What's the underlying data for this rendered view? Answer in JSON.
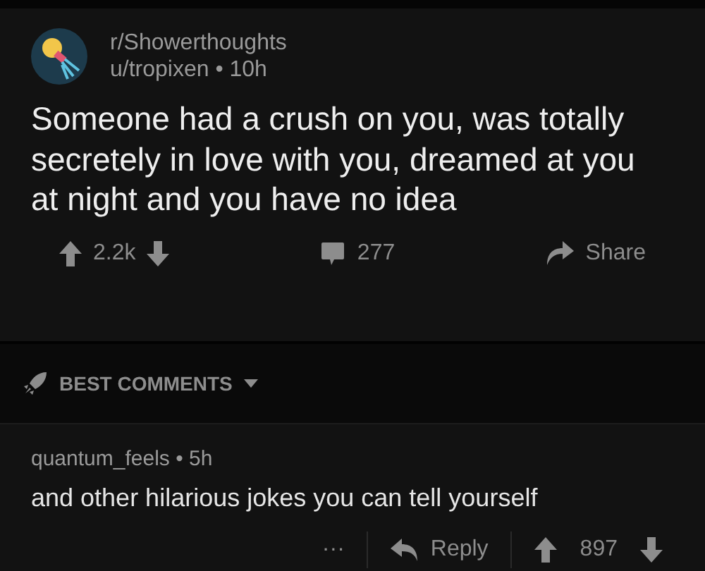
{
  "post": {
    "subreddit": "r/Showerthoughts",
    "author": "u/tropixen",
    "age": "10h",
    "separator": "•",
    "title": "Someone had a crush on you, was totally secretely in love with you, dreamed at you at night and you have no idea",
    "votes": "2.2k",
    "comments": "277",
    "share": "Share"
  },
  "sort": {
    "label": "BEST COMMENTS"
  },
  "comments": [
    {
      "author": "quantum_feels",
      "separator": "•",
      "age": "5h",
      "body": "and other hilarious jokes you can tell yourself",
      "more": "···",
      "reply": "Reply",
      "votes": "897"
    }
  ]
}
